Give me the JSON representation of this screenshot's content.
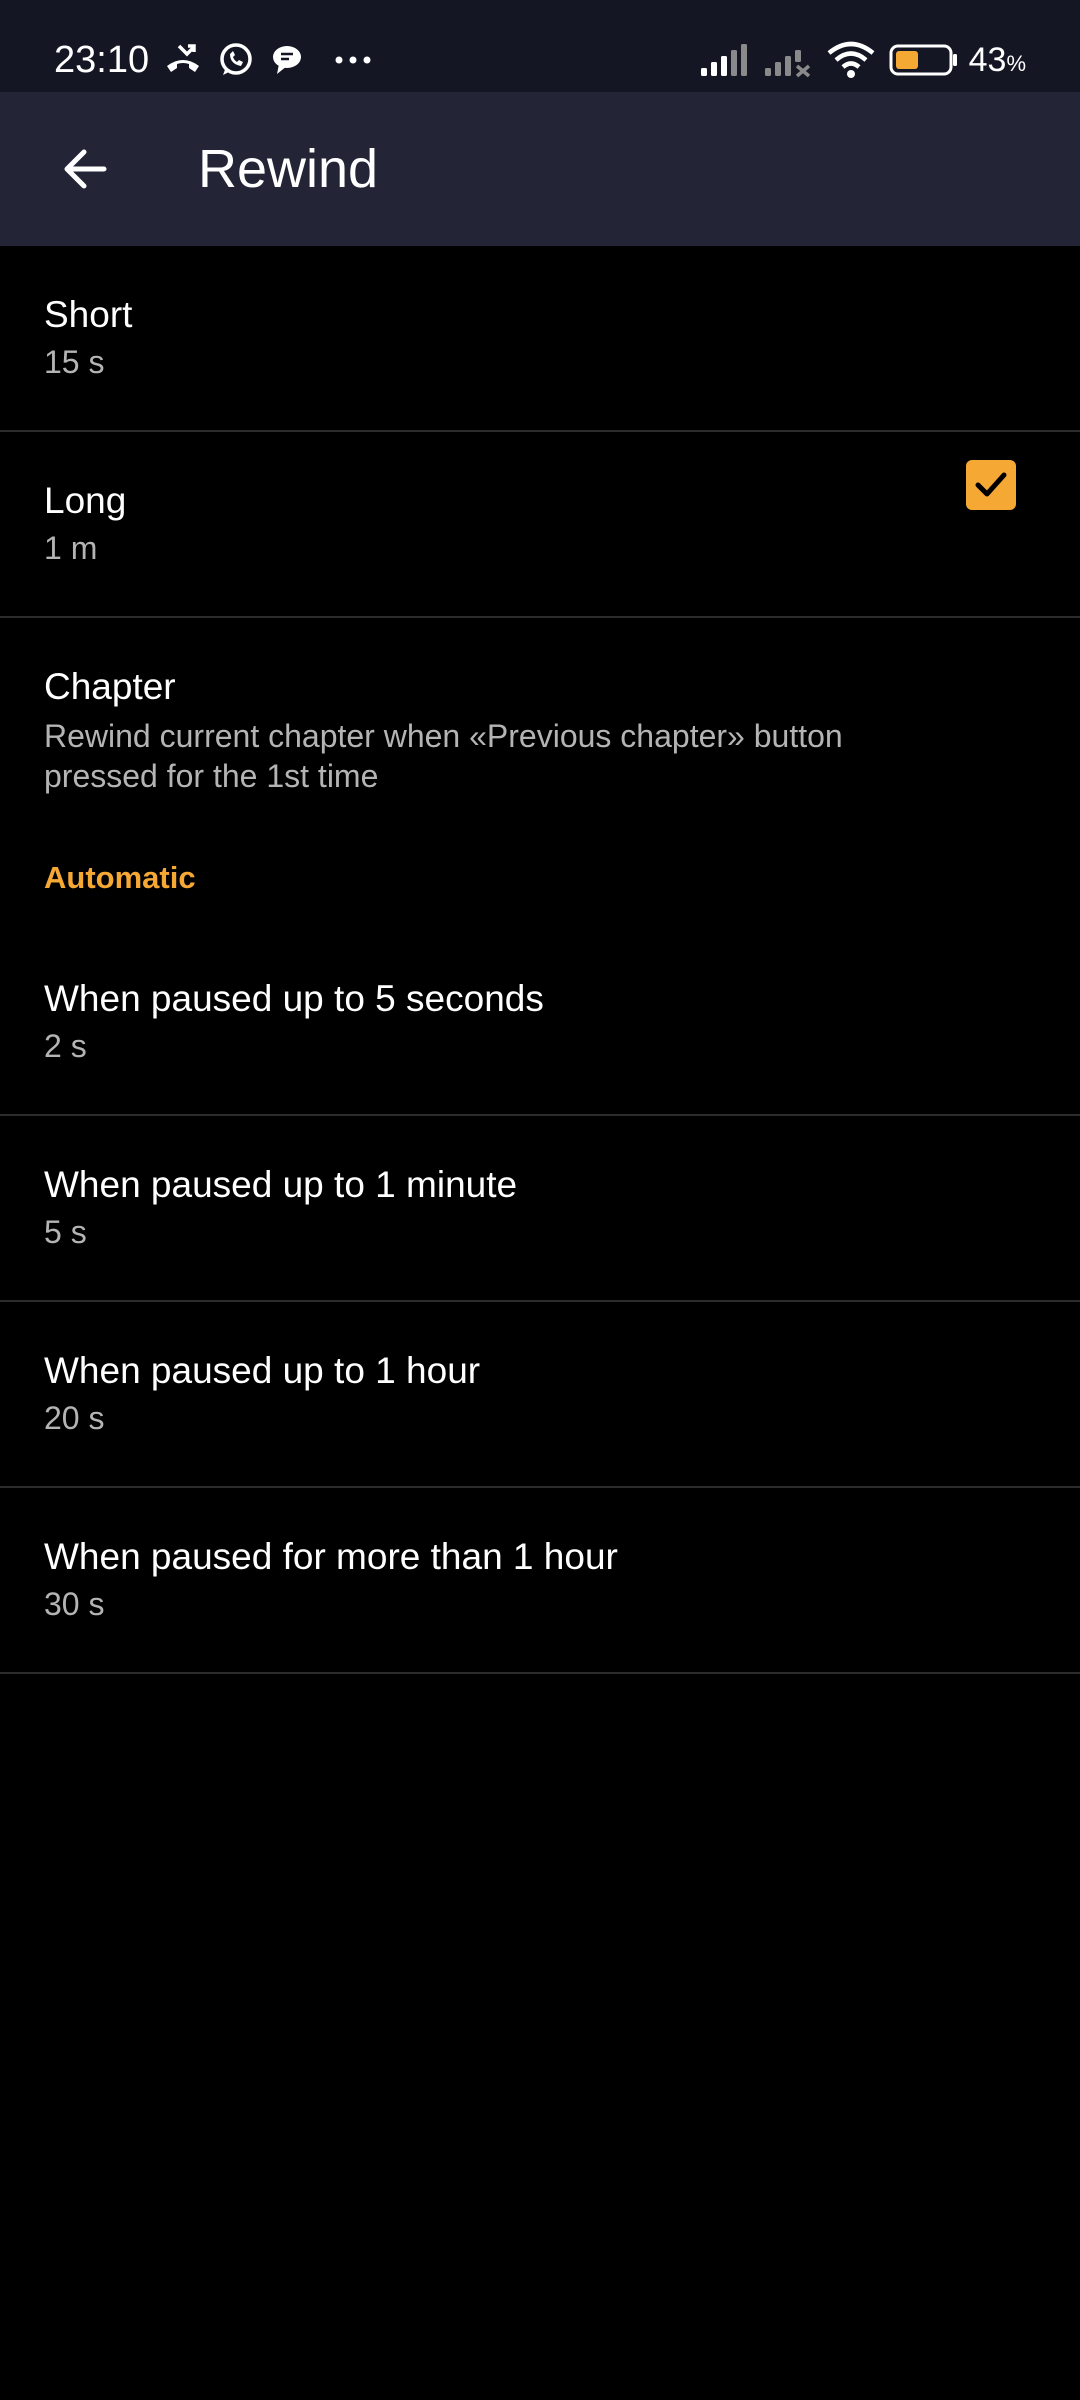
{
  "status_bar": {
    "time": "23:10",
    "battery_level": "43",
    "battery_unit": "%",
    "battery_fill_fraction": 0.43,
    "icons": [
      "missed-call-icon",
      "whatsapp-icon",
      "chat-bubble-icon",
      "more-dots-icon",
      "signal-icon",
      "signal-off-icon",
      "wifi-icon",
      "battery-icon"
    ]
  },
  "app_bar": {
    "title": "Rewind",
    "back_icon": "arrow-left-icon"
  },
  "prefs": {
    "short": {
      "title": "Short",
      "summary": "15 s"
    },
    "long": {
      "title": "Long",
      "summary": "1 m"
    },
    "chapter": {
      "title": "Chapter",
      "summary": "Rewind current chapter when «Previous chapter» button pressed for the 1st time",
      "checked": true
    }
  },
  "automatic": {
    "header": "Automatic",
    "items": [
      {
        "title": "When paused up to 5 seconds",
        "summary": "2 s"
      },
      {
        "title": "When paused up to 1 minute",
        "summary": "5 s"
      },
      {
        "title": "When paused up to 1 hour",
        "summary": "20 s"
      },
      {
        "title": "When paused for more than 1 hour",
        "summary": "30 s"
      }
    ]
  },
  "colors": {
    "accent": "#f6a835",
    "app_bar_bg": "#232436",
    "status_bar_bg": "#141624",
    "background": "#000000",
    "divider": "#2c2c2c",
    "summary_text": "#b4b4b4"
  }
}
